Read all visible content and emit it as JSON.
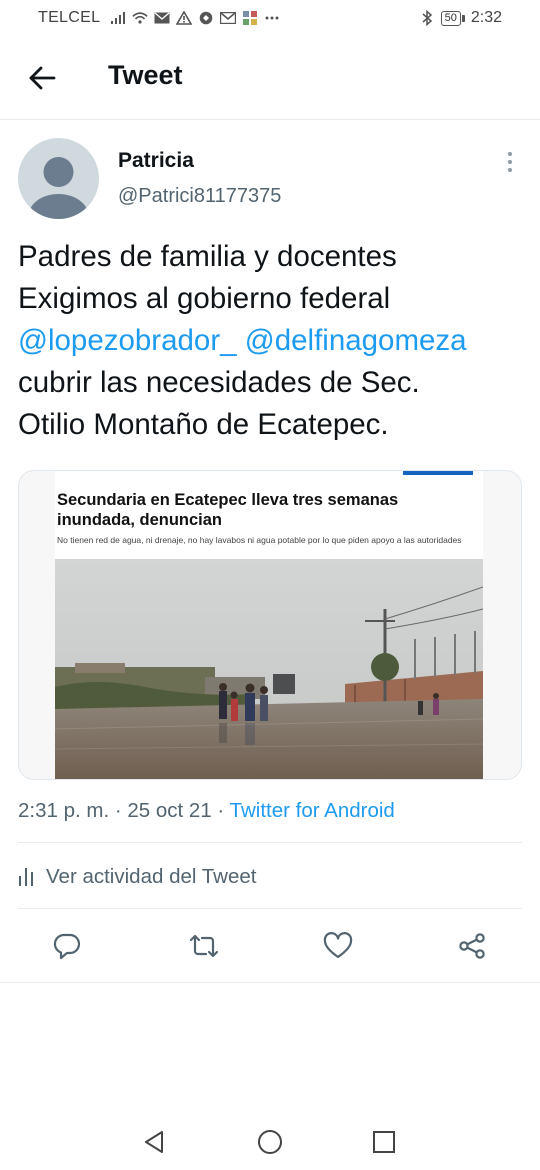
{
  "status_bar": {
    "carrier": "TELCEL",
    "battery": "50",
    "time": "2:32",
    "icons": [
      "signal-icon",
      "wifi-icon",
      "mail-icon",
      "warning-icon",
      "vpn-icon",
      "gmail-icon",
      "app-icon",
      "more-dots-icon",
      "bluetooth-icon",
      "battery-icon"
    ]
  },
  "header": {
    "title": "Tweet",
    "back_icon": "arrow-left-icon"
  },
  "author": {
    "name": "Patricia",
    "handle": "@Patrici81177375",
    "more_icon": "more-vertical-icon"
  },
  "tweet": {
    "line1": "Padres de familia y docentes",
    "line2": "Exigimos al gobierno federal",
    "mention1": "@lopezobrador_",
    "mention2": "@delfinagomeza",
    "line4": "cubrir las necesidades de Sec.",
    "line5": "Otilio Montaño de Ecatepec."
  },
  "media": {
    "headline": "Secundaria en Ecatepec lleva tres semanas inundada, denuncian",
    "subheadline": "No tienen red de agua, ni drenaje, no hay lavabos ni agua potable por lo que piden apoyo a las autoridades"
  },
  "meta": {
    "time": "2:31 p. m.",
    "sep1": " · ",
    "date": "25 oct 21",
    "sep2": " · ",
    "source": "Twitter for Android"
  },
  "activity": {
    "label": "Ver actividad del Tweet",
    "icon": "analytics-icon"
  },
  "actions": {
    "reply_icon": "reply-icon",
    "retweet_icon": "retweet-icon",
    "like_icon": "heart-icon",
    "share_icon": "share-icon"
  },
  "nav": {
    "back_icon": "nav-back-icon",
    "home_icon": "nav-home-icon",
    "recents_icon": "nav-recents-icon"
  },
  "colors": {
    "accent": "#1d9bf0",
    "text": "#0f1419",
    "secondary": "#536471",
    "divider": "#e6ecf0"
  }
}
